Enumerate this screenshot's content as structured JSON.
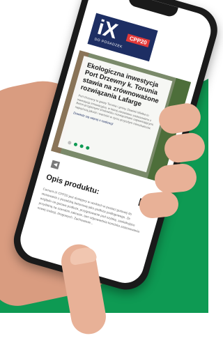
{
  "brand": {
    "logo_text": "iX",
    "logo_sub": "DO POSADZEK",
    "logo_tag": "CPP20",
    "primary_color": "#1d2e63",
    "accent_color": "#e23a3a",
    "background_green": "#0e9a53"
  },
  "hero_card": {
    "title": "Ekologiczna inwestycja Port Drzewny k. Torunia stawia na zrównoważone rozwiązania Lafarge",
    "body": "Port Drzewny to gwary Torunia i gminy Zławieś Wielka to inwestycja innowacyjna, w której ciesielstwo zastosowano z Beton przyjaznymi środowisku rozwiązaniami zapewniającymi najwyższą jakość i wartości w życiu przyszłym mieszkańców.",
    "read_more": "Dowiedz się więcej o realizacji",
    "slides": 4,
    "active_slide": 1
  },
  "carousel": {
    "prev_icon": "chevron-left-icon",
    "next_icon": "chevron-right-icon"
  },
  "product": {
    "title": "Opis produktu:",
    "text": "Cement iX CPP20 jest dostępny w workach w postaci gotowej do stosowania z posadzką betonową jako podłoża podłogowego. Ze względu na gotowe podłoże, przygotowanie pod szybką, zaskakująco przydatną na szerokim zakresie, tam odpowiednia komórka zastosowania nowej izolacji, drogowych. Zachowanie..."
  }
}
